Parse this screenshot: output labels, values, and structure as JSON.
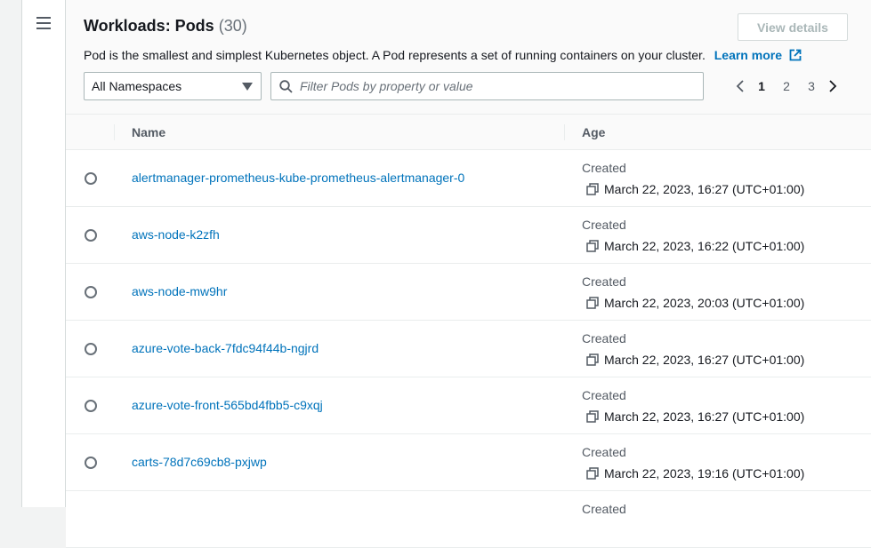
{
  "header": {
    "title": "Workloads: Pods",
    "count": "(30)",
    "view_details": "View details",
    "description": "Pod is the smallest and simplest Kubernetes object. A Pod represents a set of running containers on your cluster.",
    "learn_more": "Learn more"
  },
  "filters": {
    "namespace_selected": "All Namespaces",
    "search_placeholder": "Filter Pods by property or value"
  },
  "pagination": {
    "pages": [
      "1",
      "2",
      "3"
    ],
    "current": "1"
  },
  "table": {
    "columns": {
      "name": "Name",
      "age": "Age"
    },
    "created_label": "Created",
    "rows": [
      {
        "name": "alertmanager-prometheus-kube-prometheus-alertmanager-0",
        "created": "March 22, 2023, 16:27 (UTC+01:00)"
      },
      {
        "name": "aws-node-k2zfh",
        "created": "March 22, 2023, 16:22 (UTC+01:00)"
      },
      {
        "name": "aws-node-mw9hr",
        "created": "March 22, 2023, 20:03 (UTC+01:00)"
      },
      {
        "name": "azure-vote-back-7fdc94f44b-ngjrd",
        "created": "March 22, 2023, 16:27 (UTC+01:00)"
      },
      {
        "name": "azure-vote-front-565bd4fbb5-c9xqj",
        "created": "March 22, 2023, 16:27 (UTC+01:00)"
      },
      {
        "name": "carts-78d7c69cb8-pxjwp",
        "created": "March 22, 2023, 19:16 (UTC+01:00)"
      },
      {
        "name": "",
        "created": ""
      }
    ]
  },
  "colors": {
    "link": "#0073bb",
    "text": "#16191f",
    "muted": "#545b64",
    "border": "#eaeded"
  }
}
